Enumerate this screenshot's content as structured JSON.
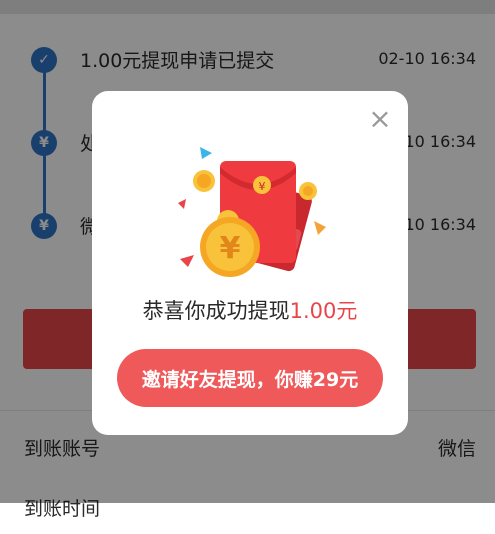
{
  "timeline": {
    "items": [
      {
        "text": "1.00元提现申请已提交",
        "time": "02-10 16:34",
        "icon": "check-icon"
      },
      {
        "text": "处",
        "time": "02-10 16:34",
        "icon": "yen-icon"
      },
      {
        "text": "微",
        "time": "02-10 16:34",
        "icon": "yen-icon"
      }
    ]
  },
  "info": {
    "account_label": "到账账号",
    "account_value": "微信",
    "time_label": "到账时间"
  },
  "modal": {
    "congrats_prefix": "恭喜你成功提现",
    "amount": "1.00元",
    "invite_button": "邀请好友提现，你赚29元",
    "close_icon": "close-icon",
    "illustration_icon": "red-envelope-icon"
  },
  "colors": {
    "accent_blue": "#2f73c6",
    "accent_red": "#e8454a",
    "button_red": "#f0595a"
  }
}
